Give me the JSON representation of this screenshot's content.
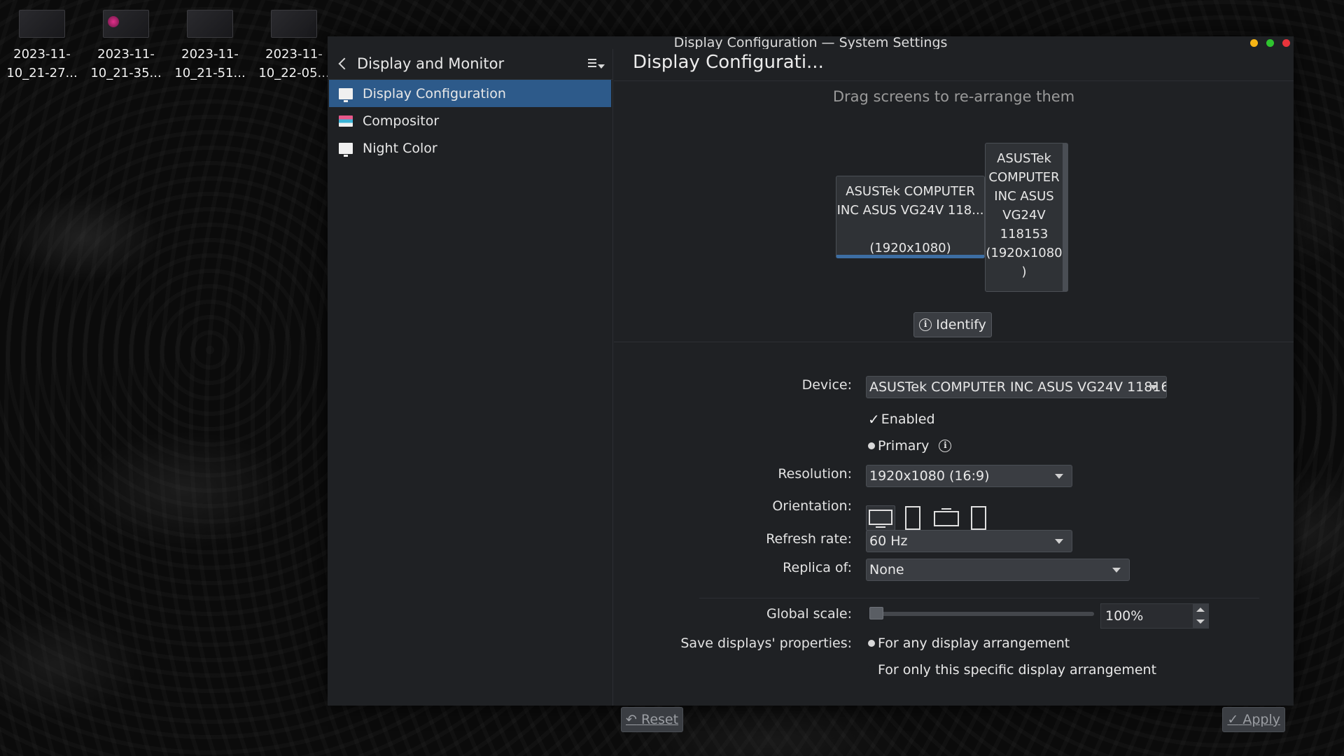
{
  "desktop": {
    "icons": [
      {
        "label_line1": "2023-11-",
        "label_line2": "10_21-27..."
      },
      {
        "label_line1": "2023-11-",
        "label_line2": "10_21-35..."
      },
      {
        "label_line1": "2023-11-",
        "label_line2": "10_21-51..."
      },
      {
        "label_line1": "2023-11-",
        "label_line2": "10_22-05..."
      }
    ]
  },
  "window": {
    "title": "Display Configuration — System Settings"
  },
  "sidebar": {
    "header_title": "Display and Monitor",
    "items": [
      {
        "label": "Display Configuration",
        "icon": "monitor-icon",
        "active": true
      },
      {
        "label": "Compositor",
        "icon": "compositor-icon",
        "active": false
      },
      {
        "label": "Night Color",
        "icon": "monitor-icon",
        "active": false
      }
    ]
  },
  "main": {
    "title": "Display Configurati...",
    "drag_hint": "Drag screens to re-arrange them",
    "screens": [
      {
        "line1": "ASUSTek COMPUTER",
        "line2": "INC ASUS VG24V 118...",
        "line3": "(1920x1080)"
      },
      {
        "lines": [
          "ASUSTek",
          "COMPUTER",
          "INC ASUS",
          "VG24V",
          "118153",
          "(1920x1080",
          ")"
        ]
      }
    ],
    "identify_label": "Identify",
    "device": {
      "label": "Device:",
      "value": "ASUSTek COMPUTER INC ASUS VG24V 11816"
    },
    "enabled": {
      "label": "Enabled",
      "checked": true
    },
    "primary": {
      "label": "Primary",
      "selected": true
    },
    "resolution": {
      "label": "Resolution:",
      "value": "1920x1080 (16:9)"
    },
    "orientation": {
      "label": "Orientation:",
      "selected": "landscape"
    },
    "refresh_rate": {
      "label": "Refresh rate:",
      "value": "60 Hz"
    },
    "replica_of": {
      "label": "Replica of:",
      "value": "None"
    },
    "global_scale": {
      "label": "Global scale:",
      "value": "100%",
      "percent": 100
    },
    "save_properties": {
      "label": "Save displays' properties:",
      "option_any": "For any display arrangement",
      "option_specific": "For only this specific display arrangement",
      "selected": "any"
    },
    "reset_label": "Reset",
    "apply_label": "Apply"
  },
  "colors": {
    "accent": "#2d5a8a",
    "window_bg": "#1f2124",
    "close": "#e8343b",
    "minimize": "#f6b515",
    "maximize": "#2fc42f"
  }
}
